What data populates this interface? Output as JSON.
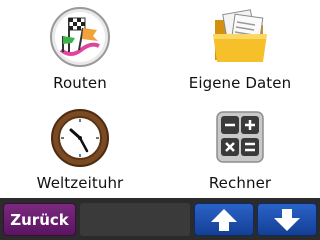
{
  "menu": {
    "items": [
      {
        "label": "Routen",
        "icon": "routes-flags-icon"
      },
      {
        "label": "Eigene Daten",
        "icon": "folder-icon"
      },
      {
        "label": "Weltzeituhr",
        "icon": "world-clock-icon"
      },
      {
        "label": "Rechner",
        "icon": "calculator-icon"
      }
    ]
  },
  "toolbar": {
    "back_label": "Zurück",
    "up_icon": "arrow-up-icon",
    "down_icon": "arrow-down-icon"
  },
  "colors": {
    "back_button": "#6a1e70",
    "scroll_buttons": "#1f50b0",
    "bar": "#2b2b2b"
  }
}
